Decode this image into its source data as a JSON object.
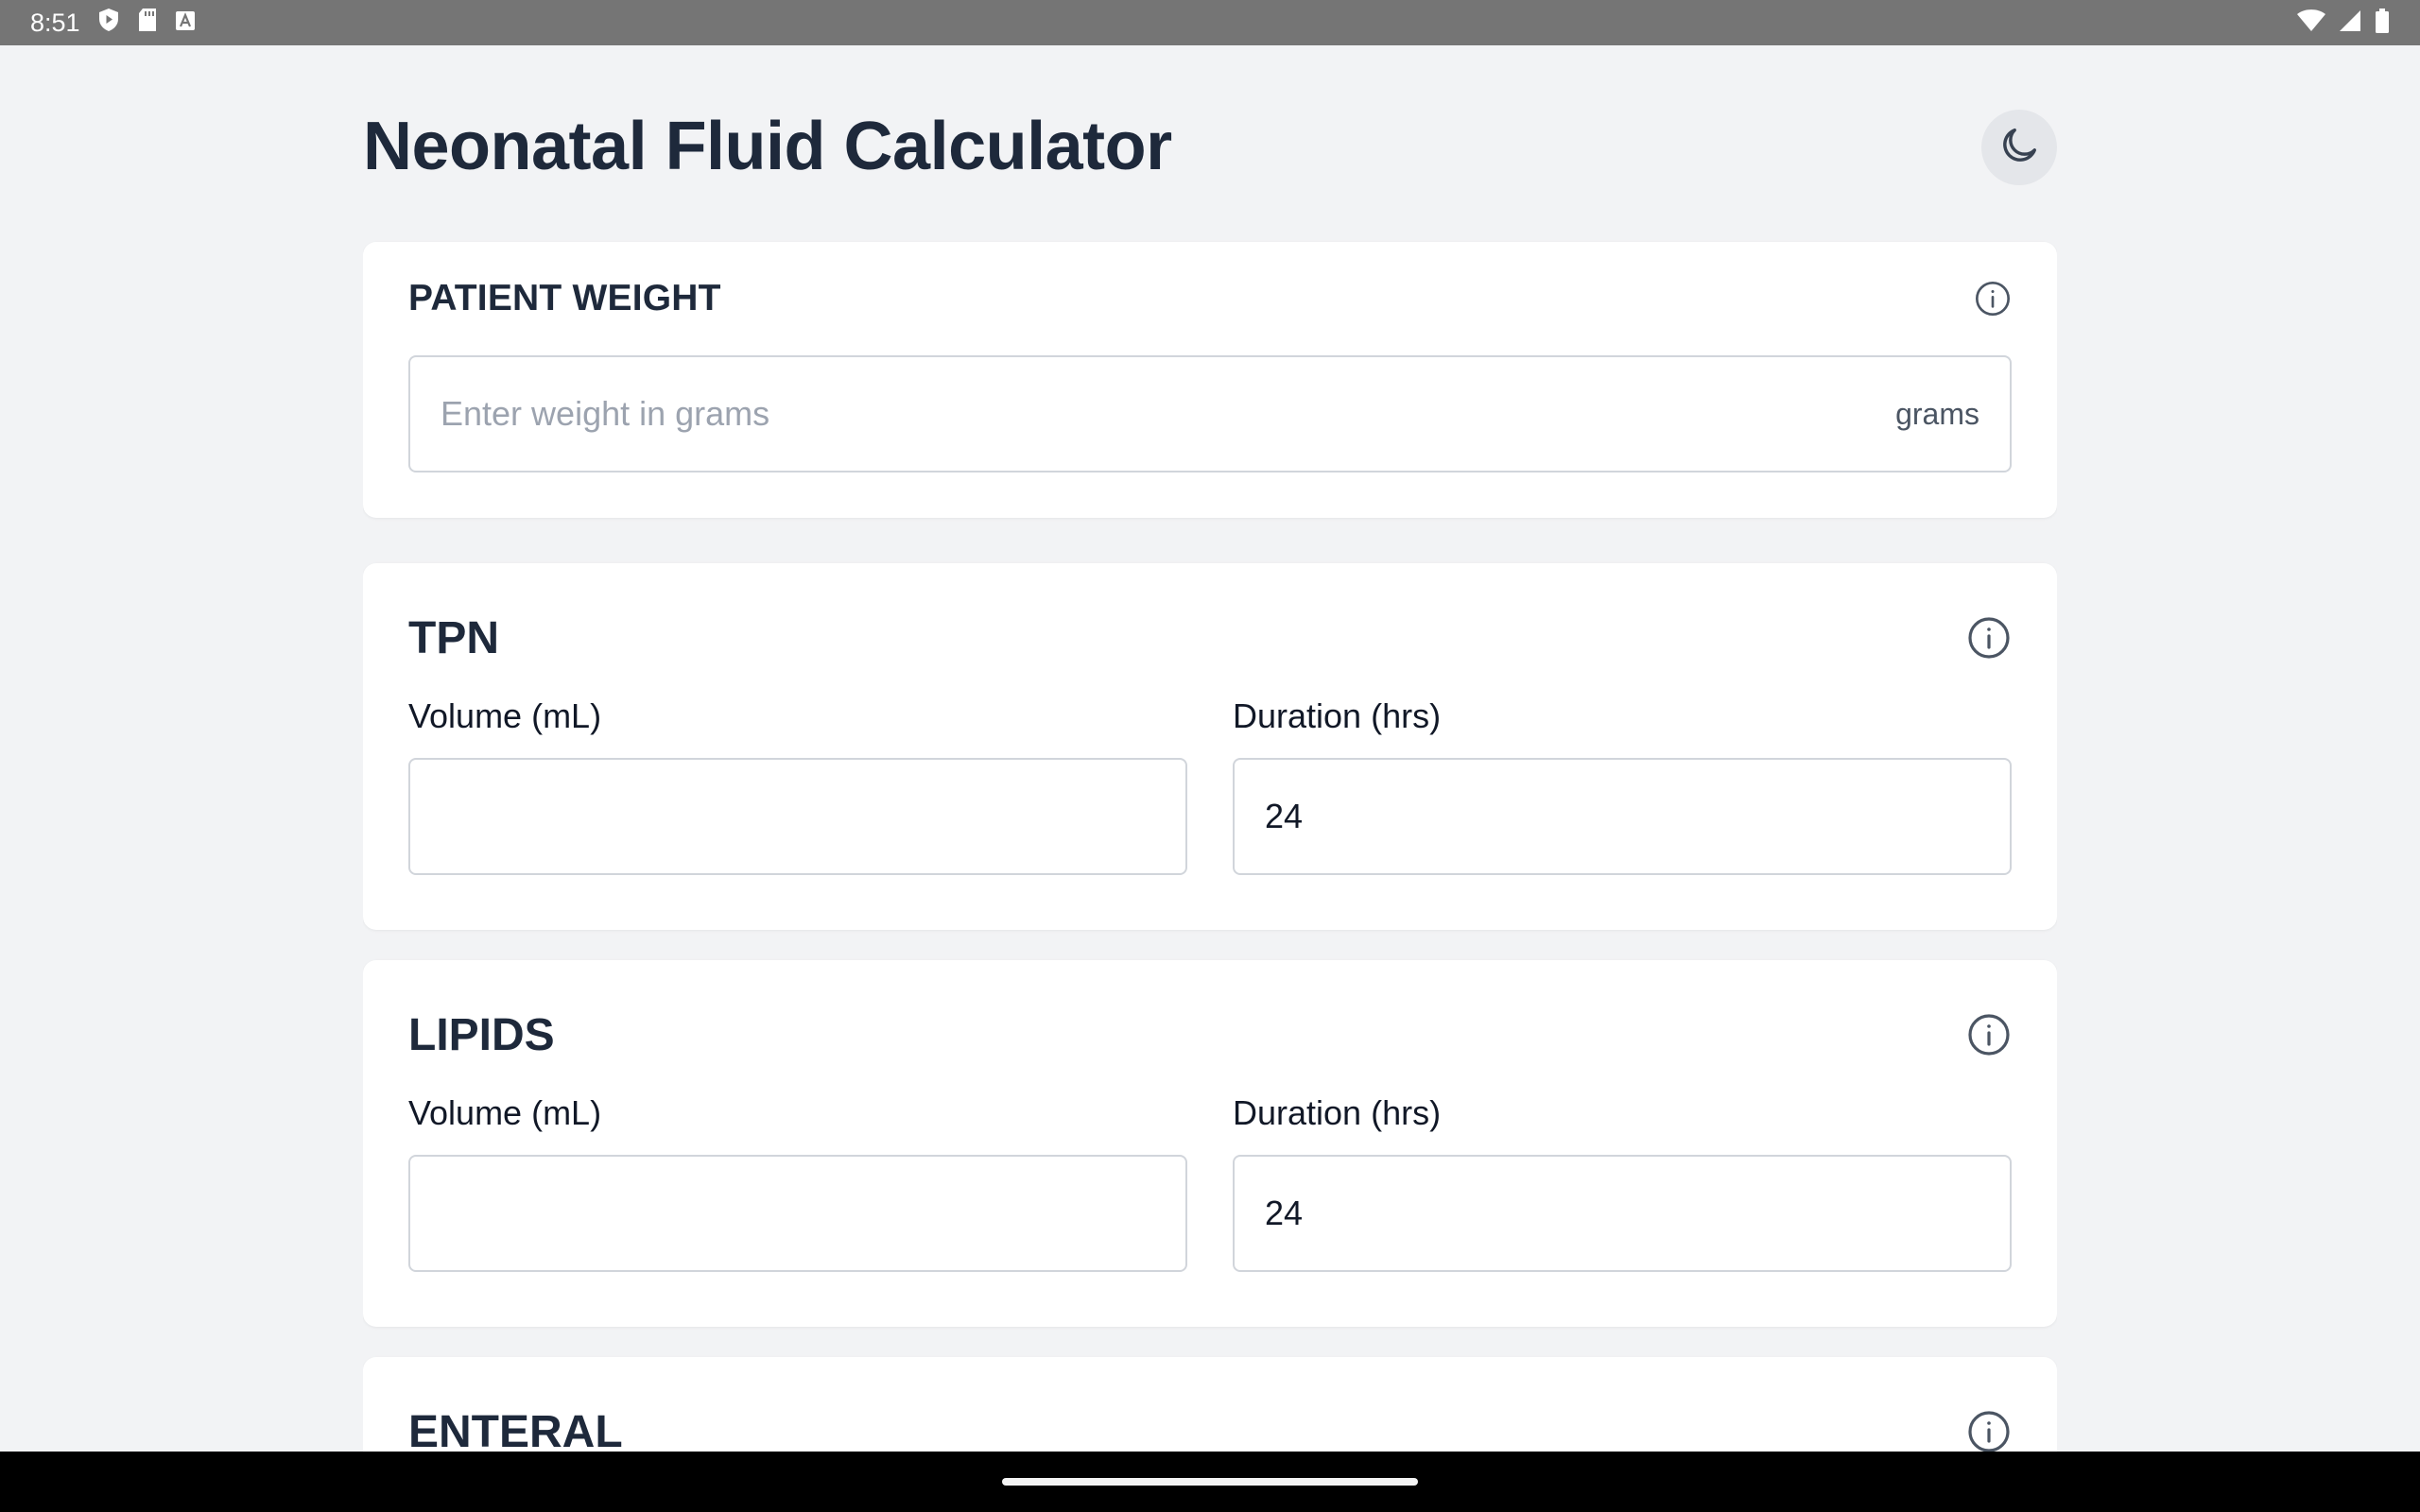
{
  "status_bar": {
    "time": "8:51",
    "left_icons": [
      "shield-play-icon",
      "sd-card-icon",
      "keyboard-a-icon"
    ],
    "right_icons": [
      "wifi-icon",
      "signal-icon",
      "battery-icon"
    ]
  },
  "header": {
    "title": "Neonatal Fluid Calculator",
    "theme_toggle_icon": "moon-icon"
  },
  "weight_card": {
    "label": "PATIENT WEIGHT",
    "input_value": "",
    "input_placeholder": "Enter weight in grams",
    "unit": "grams",
    "info_icon": "info-icon"
  },
  "tpn_card": {
    "title": "TPN",
    "volume_label": "Volume (mL)",
    "volume_value": "",
    "duration_label": "Duration (hrs)",
    "duration_value": "24",
    "info_icon": "info-icon"
  },
  "lipids_card": {
    "title": "LIPIDS",
    "volume_label": "Volume (mL)",
    "volume_value": "",
    "duration_label": "Duration (hrs)",
    "duration_value": "24",
    "info_icon": "info-icon"
  },
  "enteral_card": {
    "title": "ENTERAL",
    "info_icon": "info-icon"
  },
  "colors": {
    "background": "#f2f3f5",
    "card": "#ffffff",
    "text_primary": "#1e293b",
    "placeholder": "#9ca3af",
    "border": "#d1d5db",
    "status_bar": "#757575",
    "nav_bar": "#000000"
  }
}
